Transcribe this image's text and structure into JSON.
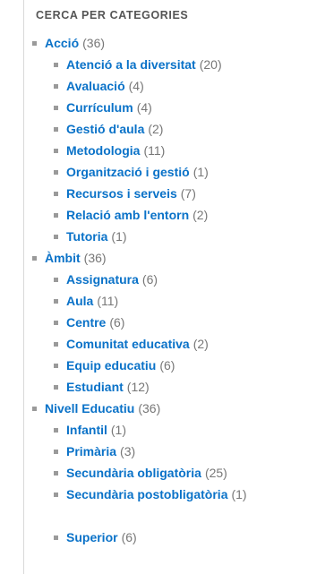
{
  "heading": "CERCA PER CATEGORIES",
  "categories": [
    {
      "label": "Acció",
      "count": "(36)",
      "children": [
        {
          "label": "Atenció a la diversitat",
          "count": "(20)"
        },
        {
          "label": "Avaluació",
          "count": "(4)"
        },
        {
          "label": "Currículum",
          "count": "(4)"
        },
        {
          "label": "Gestió d'aula",
          "count": "(2)"
        },
        {
          "label": "Metodologia",
          "count": "(11)"
        },
        {
          "label": "Organització i gestió",
          "count": "(1)"
        },
        {
          "label": "Recursos i serveis",
          "count": "(7)"
        },
        {
          "label": "Relació amb l'entorn",
          "count": "(2)"
        },
        {
          "label": "Tutoria",
          "count": "(1)"
        }
      ]
    },
    {
      "label": "Àmbit",
      "count": "(36)",
      "children": [
        {
          "label": "Assignatura",
          "count": "(6)"
        },
        {
          "label": "Aula",
          "count": "(11)"
        },
        {
          "label": "Centre",
          "count": "(6)"
        },
        {
          "label": "Comunitat educativa",
          "count": "(2)"
        },
        {
          "label": "Equip educatiu",
          "count": "(6)"
        },
        {
          "label": "Estudiant",
          "count": "(12)"
        }
      ]
    },
    {
      "label": "Nivell Educatiu",
      "count": "(36)",
      "children": [
        {
          "label": "Infantil",
          "count": "(1)"
        },
        {
          "label": "Primària",
          "count": "(3)"
        },
        {
          "label": "Secundària obligatòria",
          "count": "(25)"
        },
        {
          "label": "Secundària postobligatòria",
          "count": "(1)",
          "wrap": true
        },
        {
          "label": "Superior",
          "count": "(6)"
        }
      ]
    }
  ]
}
